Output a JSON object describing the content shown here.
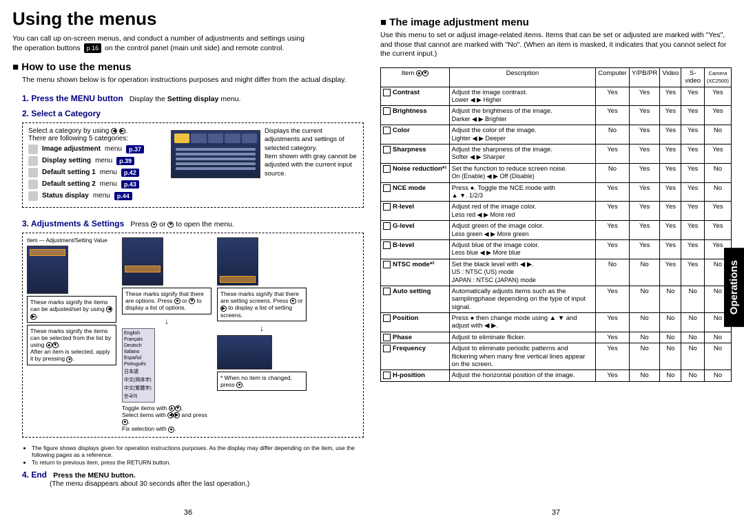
{
  "page_title": "Using the menus",
  "intro_l1": "You can call up on-screen menus, and conduct a number of adjustments and settings using",
  "intro_l2": "the operation buttons",
  "intro_pref": "p.16",
  "intro_l3": "on the control panel (main unit side) and remote control.",
  "side_tab": "Operations",
  "left": {
    "h2": "How to use the menus",
    "sub": "The menu shown below is for operation instructions purposes and might differ from the actual display.",
    "step1_label": "1. Press the MENU button",
    "step1_text_a": "Display the",
    "step1_text_b": "Setting display",
    "step1_text_c": "menu.",
    "step2_label": "2. Select a Category",
    "selcat_intro": "Select a category by using",
    "selcat_intro2": "There are following 5 categories:",
    "cats": [
      {
        "label": "Image adjustment",
        "suffix": "menu",
        "p": "p.37"
      },
      {
        "label": "Display setting",
        "suffix": "menu",
        "p": "p.39"
      },
      {
        "label": "Default setting 1",
        "suffix": "menu",
        "p": "p.42"
      },
      {
        "label": "Default setting 2",
        "suffix": "menu",
        "p": "p.43"
      },
      {
        "label": "Status display",
        "suffix": "menu",
        "p": "p.44"
      }
    ],
    "selcat_right1": "Displays the current adjustments and settings of selected category.",
    "selcat_right2": "Item shown with gray cannot be adjusted with the current input source.",
    "step3_label": "3. Adjustments & Settings",
    "step3_text": "Press",
    "step3_text2": "or",
    "step3_text3": "to open the menu.",
    "adj": {
      "label_item": "Item",
      "label_val": "Adjustment/Setting Value",
      "a1": "These marks signify the items can be adjusted/set by using",
      "a2": "These marks signify the items can be selected from the list by using",
      "a3": "After an item is selected, apply it by pressing",
      "a4": "These marks signify that there are options. Press",
      "a4b": "or",
      "a4c": "to display a list of options.",
      "a5": "These marks signify that there are setting screens. Press",
      "a5b": "or",
      "a5c": "to display a list of setting screens.",
      "a6": "* When no item is changed, press",
      "toggle": "Toggle items with",
      "select": "Select items with",
      "select2": "and press",
      "fix": "Fix selection with"
    },
    "notes": [
      "The figure shows displays given for operation instructions purposes. As the display may differ depending on the item, use the following pages as a reference.",
      "To return to previous item, press the RETURN button."
    ],
    "step4_label": "4. End",
    "step4_text": "Press the MENU button.",
    "step4_sub": "(The menu disappears about 30 seconds after the last operation.)",
    "pagenum": "36"
  },
  "right": {
    "h2": "The image adjustment menu",
    "sub": "Use this menu to set or adjust image-related items. Items that can be set or adjusted are marked with \"Yes\", and those that cannot are marked with \"No\". (When an item is masked, it indicates that you cannot select for the current input.)",
    "headers": {
      "item": "Item",
      "desc": "Description",
      "c1": "Computer",
      "c2": "Y/PB/PR",
      "c3": "Video",
      "c4": "S-video",
      "c5a": "Camera",
      "c5b": "(XC2500)"
    },
    "rows": [
      {
        "name": "Contrast",
        "desc": "Adjust the image contrast.",
        "lr": "Lower ◀ ▶ Higher",
        "v": [
          "Yes",
          "Yes",
          "Yes",
          "Yes",
          "Yes"
        ]
      },
      {
        "name": "Brightness",
        "desc": "Adjust the brightness of the image.",
        "lr": "Darker ◀ ▶ Brighter",
        "v": [
          "Yes",
          "Yes",
          "Yes",
          "Yes",
          "Yes"
        ]
      },
      {
        "name": "Color",
        "desc": "Adjust the color of the image.",
        "lr": "Lighter ◀ ▶ Deeper",
        "v": [
          "No",
          "Yes",
          "Yes",
          "Yes",
          "No"
        ]
      },
      {
        "name": "Sharpness",
        "desc": "Adjust the sharpness of the image.",
        "lr": "Softer ◀ ▶ Sharper",
        "v": [
          "Yes",
          "Yes",
          "Yes",
          "Yes",
          "Yes"
        ]
      },
      {
        "name": "Noise reduction*¹",
        "desc": "Set the function to reduce screen noise.",
        "lr": "On (Enable) ◀ ▶ Off (Disable)",
        "v": [
          "No",
          "Yes",
          "Yes",
          "Yes",
          "No"
        ]
      },
      {
        "name": "NCE mode",
        "desc": "Press ●. Toggle the NCE mode with",
        "lr": "▲ ▼.   1/2/3",
        "v": [
          "Yes",
          "Yes",
          "Yes",
          "Yes",
          "No"
        ]
      },
      {
        "name": "R-level",
        "desc": "Adjust red of the image color.",
        "lr": "Less red ◀ ▶ More red",
        "v": [
          "Yes",
          "Yes",
          "Yes",
          "Yes",
          "Yes"
        ]
      },
      {
        "name": "G-level",
        "desc": "Adjust green of the image color.",
        "lr": "Less green ◀ ▶ More green",
        "v": [
          "Yes",
          "Yes",
          "Yes",
          "Yes",
          "Yes"
        ]
      },
      {
        "name": "B-level",
        "desc": "Adjust blue of the image color.",
        "lr": "Less blue ◀ ▶ More blue",
        "v": [
          "Yes",
          "Yes",
          "Yes",
          "Yes",
          "Yes"
        ]
      },
      {
        "name": "NTSC mode*²",
        "desc": "Set the black level with ◀ ▶.",
        "lr": "US            : NTSC (US) mode\nJAPAN    : NTSC (JAPAN) mode",
        "v": [
          "No",
          "No",
          "Yes",
          "Yes",
          "No"
        ]
      },
      {
        "name": "Auto setting",
        "desc": "Automatically adjusts items such as the samplingphase depending on the type of input signal.",
        "lr": "",
        "v": [
          "Yes",
          "No",
          "No",
          "No",
          "No"
        ]
      },
      {
        "name": "Position",
        "desc": "Press ● then change mode using ▲ ▼ and adjust with ◀ ▶.",
        "lr": "",
        "v": [
          "Yes",
          "No",
          "No",
          "No",
          "No"
        ]
      },
      {
        "name": "Phase",
        "desc": "Adjust to eliminate flicker.",
        "lr": "",
        "v": [
          "Yes",
          "No",
          "No",
          "No",
          "No"
        ]
      },
      {
        "name": "Frequency",
        "desc": "Adjust to eliminate periodic patterns and flickering when many fine vertical lines appear on the screen.",
        "lr": "",
        "v": [
          "Yes",
          "No",
          "No",
          "No",
          "No"
        ]
      },
      {
        "name": "H-position",
        "desc": "Adjust the horizontal position of the image.",
        "lr": "",
        "v": [
          "Yes",
          "No",
          "No",
          "No",
          "No"
        ]
      }
    ],
    "pagenum": "37"
  }
}
